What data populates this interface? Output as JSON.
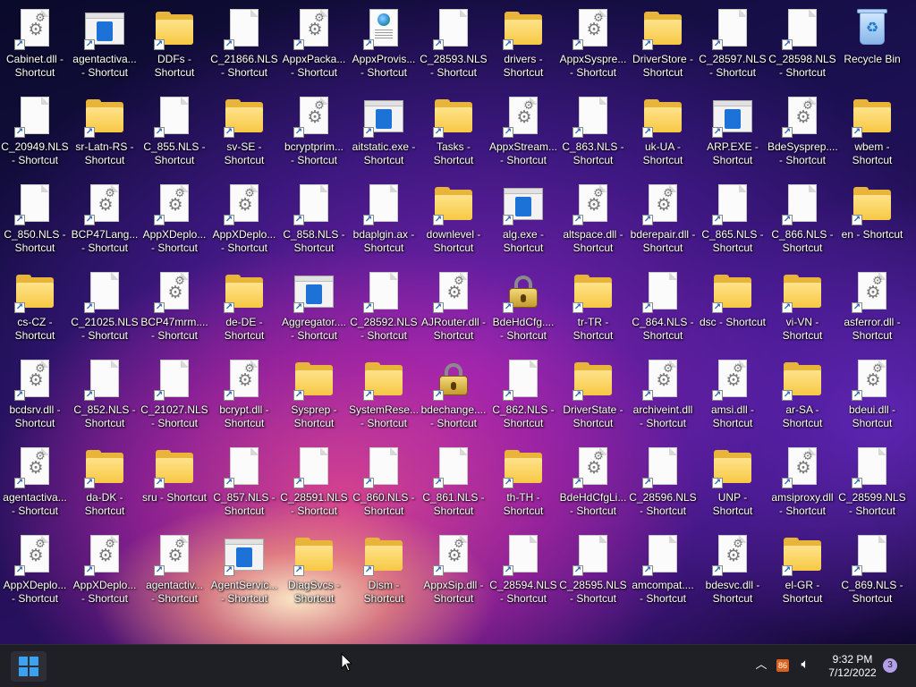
{
  "desktop": {
    "icons": [
      {
        "label": "Cabinet.dll - Shortcut",
        "kind": "dll"
      },
      {
        "label": "agentactiva...\n- Shortcut",
        "kind": "exe"
      },
      {
        "label": "DDFs -\nShortcut",
        "kind": "folder"
      },
      {
        "label": "C_21866.NLS\n- Shortcut",
        "kind": "doc"
      },
      {
        "label": "AppxPacka...\n- Shortcut",
        "kind": "dll"
      },
      {
        "label": "AppxProvis...\n- Shortcut",
        "kind": "web"
      },
      {
        "label": "C_28593.NLS\n- Shortcut",
        "kind": "doc"
      },
      {
        "label": "drivers -\nShortcut",
        "kind": "folder"
      },
      {
        "label": "AppxSyspre...\n- Shortcut",
        "kind": "dll"
      },
      {
        "label": "DriverStore -\nShortcut",
        "kind": "folder"
      },
      {
        "label": "C_28597.NLS\n- Shortcut",
        "kind": "doc"
      },
      {
        "label": "C_28598.NLS\n- Shortcut",
        "kind": "doc"
      },
      {
        "label": "Recycle Bin",
        "kind": "bin"
      },
      {
        "label": "C_20949.NLS\n- Shortcut",
        "kind": "doc"
      },
      {
        "label": "sr-Latn-RS -\nShortcut",
        "kind": "folder"
      },
      {
        "label": "C_855.NLS -\nShortcut",
        "kind": "doc"
      },
      {
        "label": "sv-SE -\nShortcut",
        "kind": "folder"
      },
      {
        "label": "bcryptprim...\n- Shortcut",
        "kind": "dll"
      },
      {
        "label": "aitstatic.exe -\nShortcut",
        "kind": "exe"
      },
      {
        "label": "Tasks -\nShortcut",
        "kind": "folder"
      },
      {
        "label": "AppxStream...\n- Shortcut",
        "kind": "dll"
      },
      {
        "label": "C_863.NLS -\nShortcut",
        "kind": "doc"
      },
      {
        "label": "uk-UA -\nShortcut",
        "kind": "folder"
      },
      {
        "label": "ARP.EXE -\nShortcut",
        "kind": "exe"
      },
      {
        "label": "BdeSysprep....\n- Shortcut",
        "kind": "dll"
      },
      {
        "label": "wbem -\nShortcut",
        "kind": "folder"
      },
      {
        "label": "C_850.NLS -\nShortcut",
        "kind": "doc"
      },
      {
        "label": "BCP47Lang...\n- Shortcut",
        "kind": "dll"
      },
      {
        "label": "AppXDeplo...\n- Shortcut",
        "kind": "dll"
      },
      {
        "label": "AppXDeplo...\n- Shortcut",
        "kind": "dll"
      },
      {
        "label": "C_858.NLS -\nShortcut",
        "kind": "doc"
      },
      {
        "label": "bdaplgin.ax -\nShortcut",
        "kind": "doc"
      },
      {
        "label": "downlevel -\nShortcut",
        "kind": "folder"
      },
      {
        "label": "alg.exe -\nShortcut",
        "kind": "exe"
      },
      {
        "label": "altspace.dll -\nShortcut",
        "kind": "dll"
      },
      {
        "label": "bderepair.dll -\nShortcut",
        "kind": "dll"
      },
      {
        "label": "C_865.NLS -\nShortcut",
        "kind": "doc"
      },
      {
        "label": "C_866.NLS -\nShortcut",
        "kind": "doc"
      },
      {
        "label": "en - Shortcut",
        "kind": "folder"
      },
      {
        "label": "cs-CZ -\nShortcut",
        "kind": "folder"
      },
      {
        "label": "C_21025.NLS\n- Shortcut",
        "kind": "doc"
      },
      {
        "label": "BCP47mrm....\n- Shortcut",
        "kind": "dll"
      },
      {
        "label": "de-DE -\nShortcut",
        "kind": "folder"
      },
      {
        "label": "Aggregator....\n- Shortcut",
        "kind": "exe"
      },
      {
        "label": "C_28592.NLS\n- Shortcut",
        "kind": "doc"
      },
      {
        "label": "AJRouter.dll -\nShortcut",
        "kind": "dll"
      },
      {
        "label": "BdeHdCfg....\n- Shortcut",
        "kind": "lock"
      },
      {
        "label": "tr-TR -\nShortcut",
        "kind": "folder"
      },
      {
        "label": "C_864.NLS -\nShortcut",
        "kind": "doc"
      },
      {
        "label": "dsc - Shortcut",
        "kind": "folder"
      },
      {
        "label": "vi-VN -\nShortcut",
        "kind": "folder"
      },
      {
        "label": "asferror.dll -\nShortcut",
        "kind": "dll"
      },
      {
        "label": "bcdsrv.dll -\nShortcut",
        "kind": "dll"
      },
      {
        "label": "C_852.NLS -\nShortcut",
        "kind": "doc"
      },
      {
        "label": "C_21027.NLS\n- Shortcut",
        "kind": "doc"
      },
      {
        "label": "bcrypt.dll -\nShortcut",
        "kind": "dll"
      },
      {
        "label": "Sysprep -\nShortcut",
        "kind": "folder"
      },
      {
        "label": "SystemRese...\n- Shortcut",
        "kind": "folder"
      },
      {
        "label": "bdechange....\n- Shortcut",
        "kind": "lock"
      },
      {
        "label": "C_862.NLS -\nShortcut",
        "kind": "doc"
      },
      {
        "label": "DriverState -\nShortcut",
        "kind": "folder"
      },
      {
        "label": "archiveint.dll\n- Shortcut",
        "kind": "dll"
      },
      {
        "label": "amsi.dll -\nShortcut",
        "kind": "dll"
      },
      {
        "label": "ar-SA -\nShortcut",
        "kind": "folder"
      },
      {
        "label": "bdeui.dll -\nShortcut",
        "kind": "dll"
      },
      {
        "label": "agentactiva...\n- Shortcut",
        "kind": "dll"
      },
      {
        "label": "da-DK -\nShortcut",
        "kind": "folder"
      },
      {
        "label": "sru - Shortcut",
        "kind": "folder"
      },
      {
        "label": "C_857.NLS -\nShortcut",
        "kind": "doc"
      },
      {
        "label": "C_28591.NLS\n- Shortcut",
        "kind": "doc"
      },
      {
        "label": "C_860.NLS -\nShortcut",
        "kind": "doc"
      },
      {
        "label": "C_861.NLS -\nShortcut",
        "kind": "doc"
      },
      {
        "label": "th-TH -\nShortcut",
        "kind": "folder"
      },
      {
        "label": "BdeHdCfgLi...\n- Shortcut",
        "kind": "dll"
      },
      {
        "label": "C_28596.NLS\n- Shortcut",
        "kind": "doc"
      },
      {
        "label": "UNP -\nShortcut",
        "kind": "folder"
      },
      {
        "label": "amsiproxy.dll\n- Shortcut",
        "kind": "dll"
      },
      {
        "label": "C_28599.NLS\n- Shortcut",
        "kind": "doc"
      },
      {
        "label": "AppXDeplo...\n- Shortcut",
        "kind": "dll"
      },
      {
        "label": "AppXDeplo...\n- Shortcut",
        "kind": "dll"
      },
      {
        "label": "agentactiv...\n- Shortcut",
        "kind": "dll"
      },
      {
        "label": "AgentServic...\n- Shortcut",
        "kind": "exe"
      },
      {
        "label": "DiagSvcs -\nShortcut",
        "kind": "folder"
      },
      {
        "label": "Dism -\nShortcut",
        "kind": "folder"
      },
      {
        "label": "AppxSip.dll -\nShortcut",
        "kind": "dll"
      },
      {
        "label": "C_28594.NLS\n- Shortcut",
        "kind": "doc"
      },
      {
        "label": "C_28595.NLS\n- Shortcut",
        "kind": "doc"
      },
      {
        "label": "amcompat....\n- Shortcut",
        "kind": "doc"
      },
      {
        "label": "bdesvc.dll -\nShortcut",
        "kind": "dll"
      },
      {
        "label": "el-GR -\nShortcut",
        "kind": "folder"
      },
      {
        "label": "C_869.NLS -\nShortcut",
        "kind": "doc"
      }
    ]
  },
  "taskbar": {
    "start_icon": "windows-start-icon",
    "tray": {
      "chevron_icon": "chevron-up-icon",
      "badge_text": "86",
      "volume_icon": "speaker-icon",
      "time": "9:32 PM",
      "date": "7/12/2022",
      "notification_count": "3"
    }
  },
  "colors": {
    "taskbar_bg": "#1f1f26",
    "folder": "#f7c843",
    "exe_accent": "#1d72d8",
    "start_accent": "#3aa2f0"
  }
}
